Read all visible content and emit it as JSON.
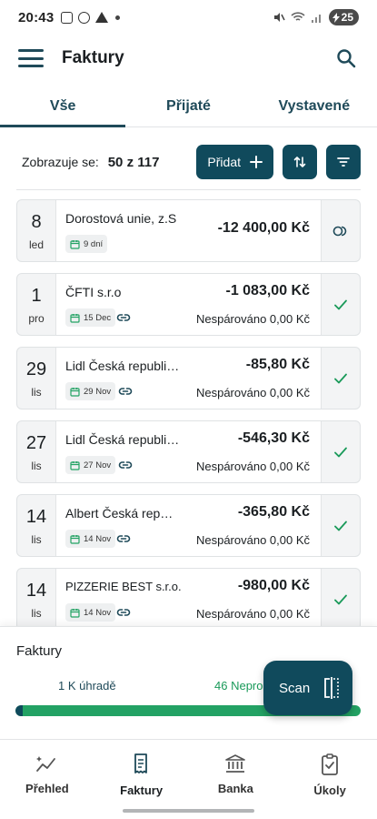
{
  "status_bar": {
    "time": "20:43",
    "battery": "25"
  },
  "app_bar": {
    "title": "Faktury",
    "menu_icon": "menu-icon",
    "search_icon": "search-icon"
  },
  "tabs": [
    {
      "label": "Vše",
      "active": true
    },
    {
      "label": "Přijaté",
      "active": false
    },
    {
      "label": "Vystavené",
      "active": false
    }
  ],
  "toolbar": {
    "showing_label": "Zobrazuje se:",
    "showing_count": "50 z 117",
    "add_label": "Přidat"
  },
  "invoices": [
    {
      "day": "8",
      "month": "led",
      "vendor": "Dorostová unie, z.S",
      "amount": "-12 400,00 Kč",
      "chip": "9 dní",
      "linked": false,
      "status": "",
      "side_icon": "pending-icon"
    },
    {
      "day": "1",
      "month": "pro",
      "vendor": "ČFTI s.r.o",
      "amount": "-1 083,00 Kč",
      "chip": "15 Dec",
      "linked": true,
      "status": "Nespárováno 0,00 Kč",
      "side_icon": "check-icon"
    },
    {
      "day": "29",
      "month": "lis",
      "vendor": "Lidl Česká republi…",
      "amount": "-85,80 Kč",
      "chip": "29 Nov",
      "linked": true,
      "status": "Nespárováno 0,00 Kč",
      "side_icon": "check-icon"
    },
    {
      "day": "27",
      "month": "lis",
      "vendor": "Lidl Česká republi…",
      "amount": "-546,30 Kč",
      "chip": "27 Nov",
      "linked": true,
      "status": "Nespárováno 0,00 Kč",
      "side_icon": "check-icon"
    },
    {
      "day": "14",
      "month": "lis",
      "vendor": "Albert Česká rep…",
      "amount": "-365,80 Kč",
      "chip": "14 Nov",
      "linked": true,
      "status": "Nespárováno 0,00 Kč",
      "side_icon": "check-icon"
    },
    {
      "day": "14",
      "month": "lis",
      "vendor": "PIZZERIE BEST s.r.o.",
      "amount": "-980,00 Kč",
      "chip": "14 Nov",
      "linked": true,
      "status": "Nespárováno 0,00 Kč",
      "side_icon": "check-icon"
    }
  ],
  "summary": {
    "title": "Faktury",
    "unpaid_label": "1 K úhradě",
    "unmatched_label": "46 Nepro",
    "progress_fraction": 0.02,
    "scan_label": "Scan"
  },
  "bottom_nav": [
    {
      "label": "Přehled",
      "icon": "trend-icon",
      "active": false
    },
    {
      "label": "Faktury",
      "icon": "invoice-icon",
      "active": true
    },
    {
      "label": "Banka",
      "icon": "bank-icon",
      "active": false
    },
    {
      "label": "Úkoly",
      "icon": "tasks-icon",
      "active": false
    }
  ],
  "colors": {
    "primary": "#104a5c",
    "accent_green": "#23a264",
    "text": "#1b1f22"
  }
}
